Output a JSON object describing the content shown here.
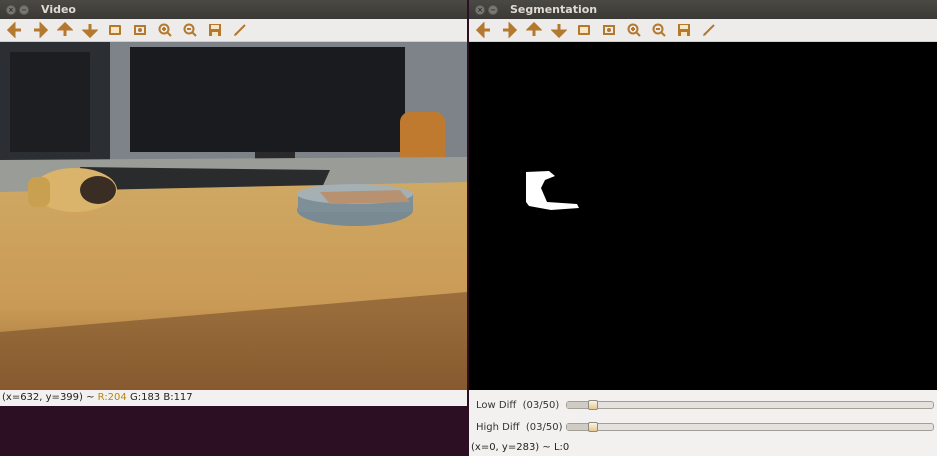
{
  "windows": {
    "video": {
      "title": "Video",
      "status": {
        "prefix": "(x=632, y=399) ~ ",
        "r": "R:204",
        "rest": " G:183 B:117"
      }
    },
    "segmentation": {
      "title": "Segmentation",
      "trackbars": [
        {
          "label": "Low Diff",
          "value": "(03/50)",
          "fraction": 0.06
        },
        {
          "label": "High Diff",
          "value": "(03/50)",
          "fraction": 0.06
        }
      ],
      "status": "(x=0, y=283) ~ L:0"
    }
  },
  "window_buttons": {
    "close": "×",
    "minimize": "−"
  },
  "toolbar_icons": [
    "pan-left-icon",
    "pan-right-icon",
    "pan-up-icon",
    "pan-down-icon",
    "zoom-reset-icon",
    "zoom-fit-icon",
    "zoom-in-icon",
    "zoom-out-icon",
    "save-icon",
    "properties-icon"
  ],
  "colors": {
    "titlebar": "#3c3b37",
    "icon_accent": "#b4782f",
    "desktop": "#2c0f22",
    "status_red": "#b8860b"
  }
}
